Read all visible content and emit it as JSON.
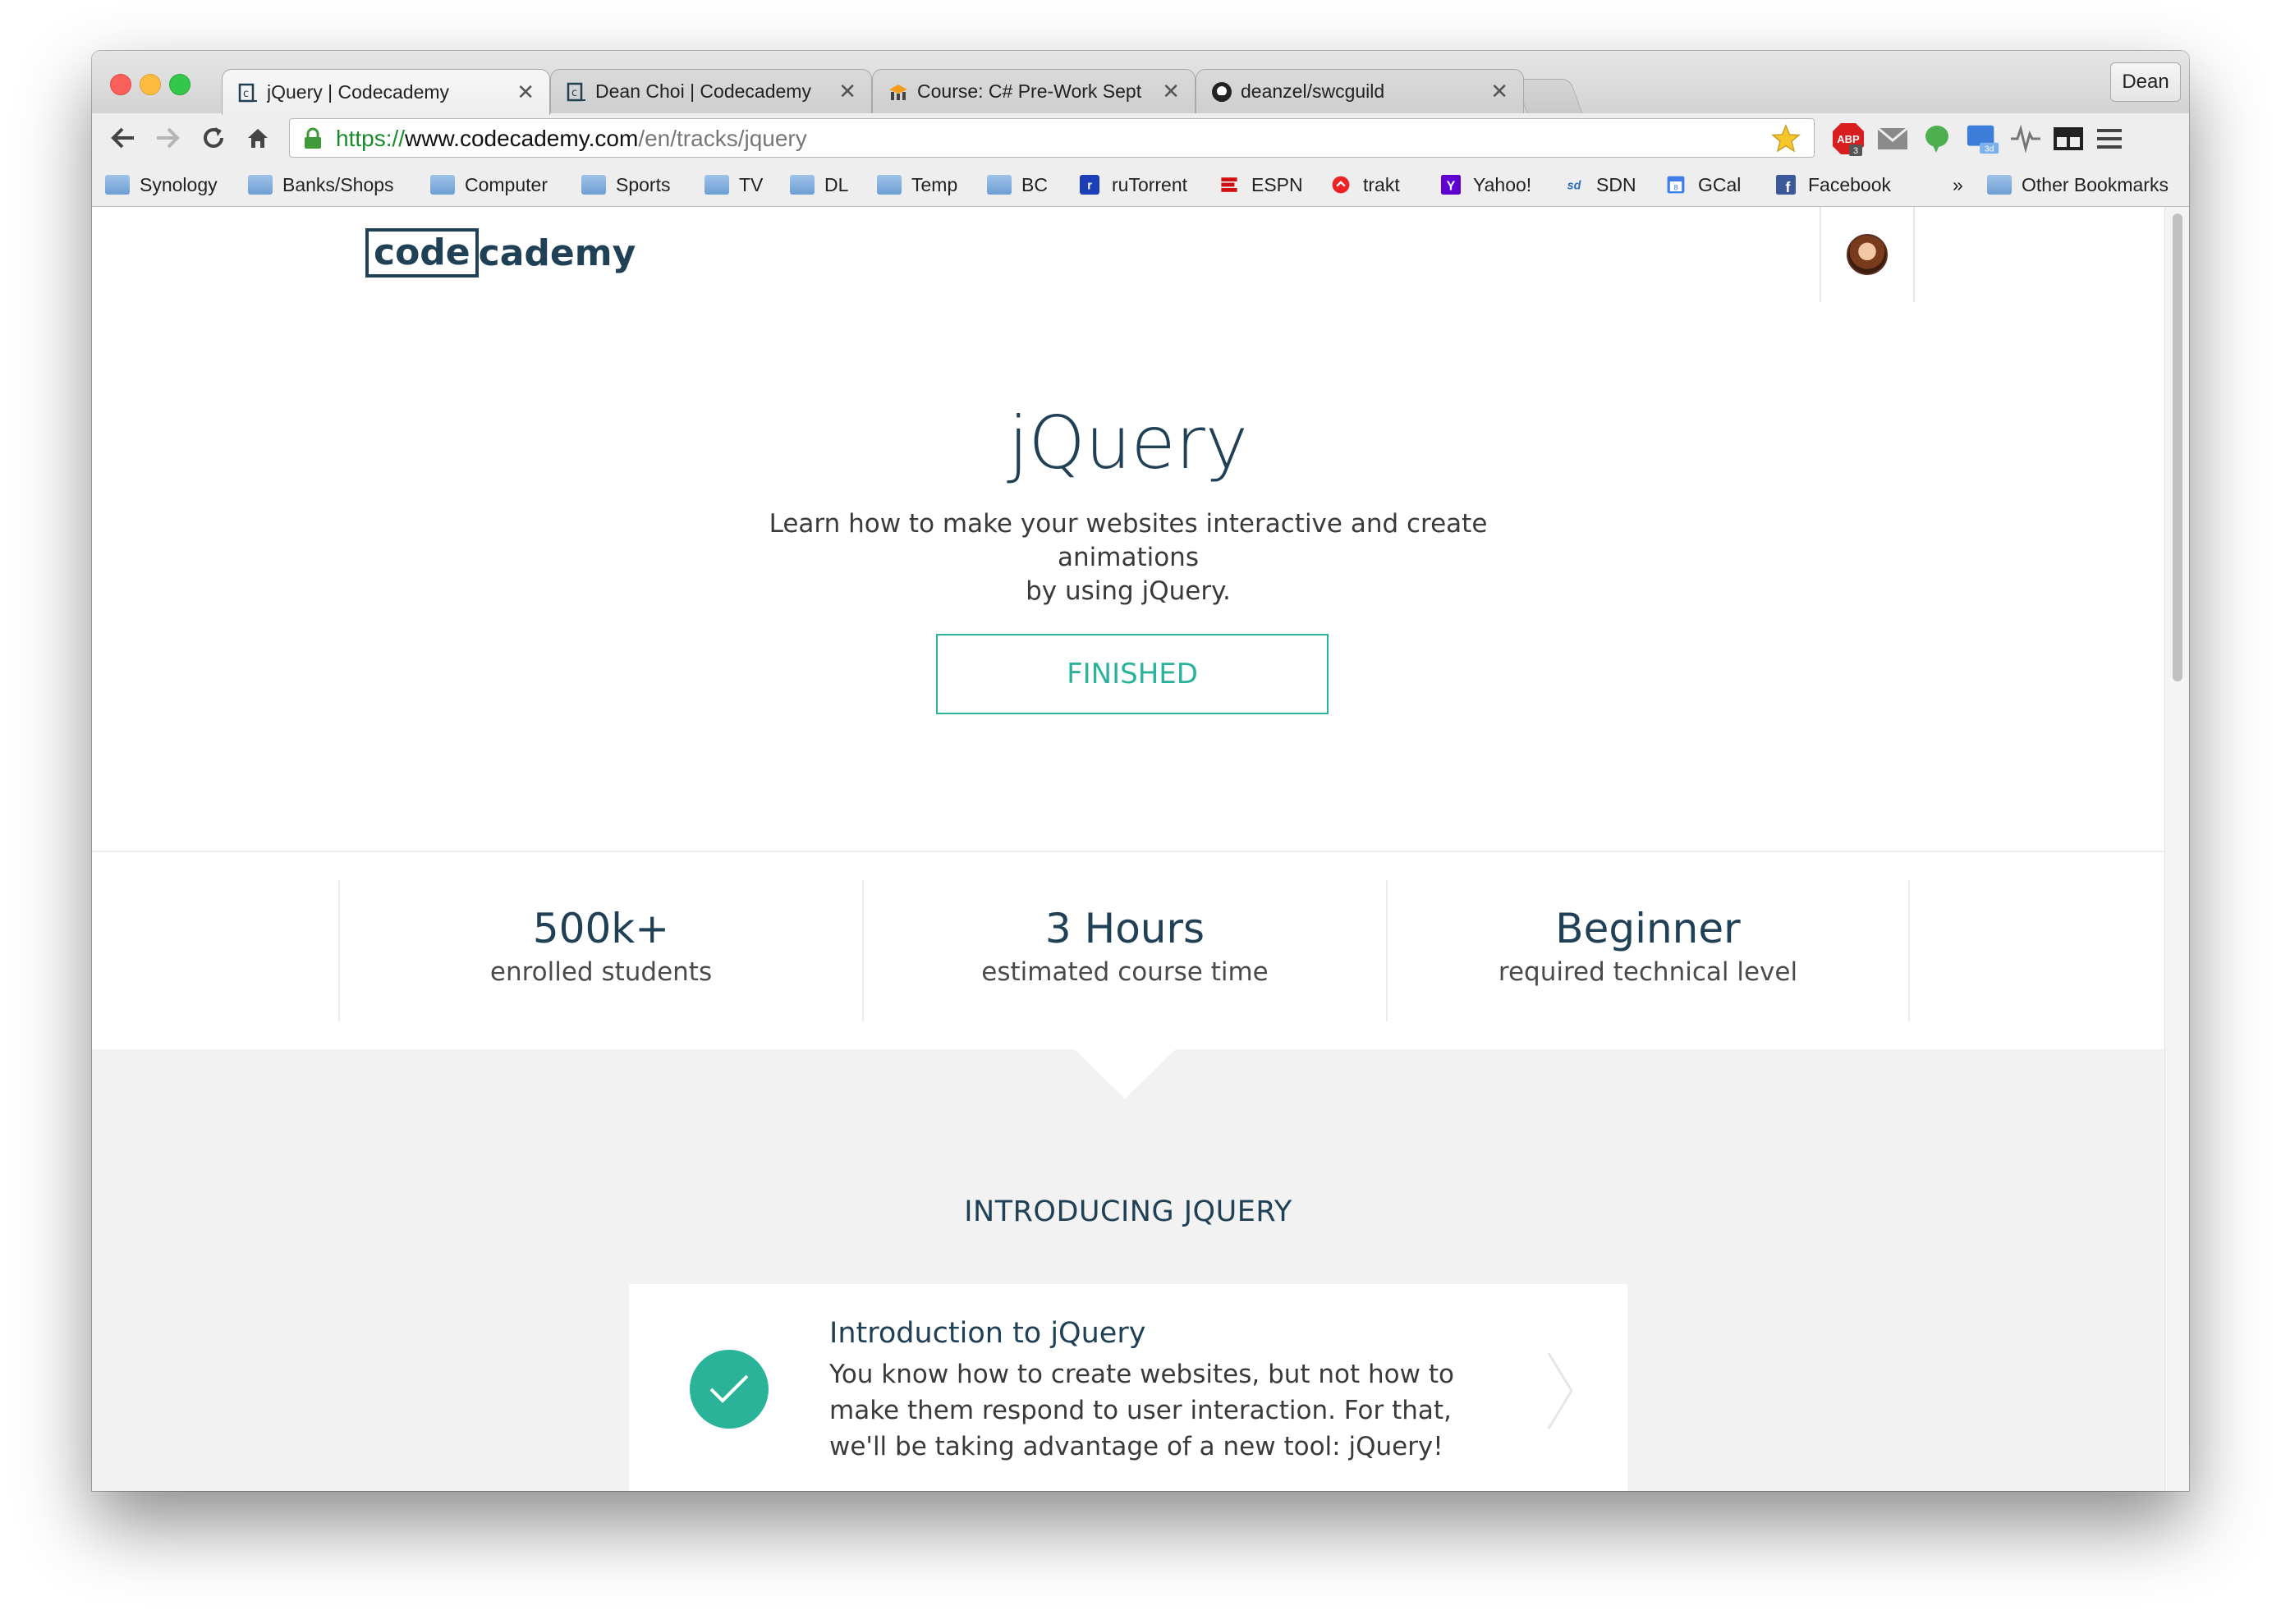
{
  "browser": {
    "tabs": [
      {
        "title": "jQuery | Codecademy",
        "favicon": "codecademy-icon",
        "active": true
      },
      {
        "title": "Dean Choi | Codecademy",
        "favicon": "codecademy-icon",
        "active": false
      },
      {
        "title": "Course: C# Pre-Work Sept",
        "favicon": "moodle-icon",
        "active": false
      },
      {
        "title": "deanzel/swcguild",
        "favicon": "github-icon",
        "active": false
      }
    ],
    "tab_close_glyph": "✕",
    "profile_name": "Dean",
    "url": {
      "scheme": "https://",
      "host": "www.codecademy.com",
      "path": "/en/tracks/jquery"
    },
    "extensions": [
      {
        "name": "adblock-plus-icon",
        "badge": "3"
      },
      {
        "name": "mail-icon"
      },
      {
        "name": "evernote-icon"
      },
      {
        "name": "screen-capture-icon",
        "badge": "3d"
      },
      {
        "name": "pulse-icon"
      },
      {
        "name": "reader-icon"
      }
    ],
    "bookmarks": [
      {
        "label": "Synology",
        "icon": "folder-icon"
      },
      {
        "label": "Banks/Shops",
        "icon": "folder-icon"
      },
      {
        "label": "Computer",
        "icon": "folder-icon"
      },
      {
        "label": "Sports",
        "icon": "folder-icon"
      },
      {
        "label": "TV",
        "icon": "folder-icon"
      },
      {
        "label": "DL",
        "icon": "folder-icon"
      },
      {
        "label": "Temp",
        "icon": "folder-icon"
      },
      {
        "label": "BC",
        "icon": "folder-icon"
      },
      {
        "label": "ruTorrent",
        "icon": "rutorrent-icon"
      },
      {
        "label": "ESPN",
        "icon": "espn-icon"
      },
      {
        "label": "trakt",
        "icon": "trakt-icon"
      },
      {
        "label": "Yahoo!",
        "icon": "yahoo-icon"
      },
      {
        "label": "SDN",
        "icon": "sdn-icon"
      },
      {
        "label": "GCal",
        "icon": "gcal-icon",
        "badge": "8"
      },
      {
        "label": "Facebook",
        "icon": "facebook-icon"
      }
    ],
    "bookmarks_overflow": "»",
    "other_bookmarks": "Other Bookmarks"
  },
  "site": {
    "logo": {
      "boxed": "code",
      "rest": "cademy"
    },
    "hero": {
      "title": "jQuery",
      "description_line1": "Learn how to make your websites interactive and create animations",
      "description_line2": "by using jQuery.",
      "status_button": "FINISHED"
    },
    "stats": [
      {
        "value": "500k+",
        "label": "enrolled students"
      },
      {
        "value": "3 Hours",
        "label": "estimated course time"
      },
      {
        "value": "Beginner",
        "label": "required technical level"
      }
    ],
    "section_title": "INTRODUCING JQUERY",
    "lesson": {
      "title": "Introduction to jQuery",
      "description": "You know how to create websites, but not how to make them respond to user interaction. For that, we'll be taking advantage of a new tool: jQuery!",
      "completed": true
    }
  },
  "colors": {
    "brand_navy": "#204056",
    "accent_teal": "#2bb39a",
    "url_green": "#1a8c2b",
    "section_grey": "#f2f2f2"
  }
}
